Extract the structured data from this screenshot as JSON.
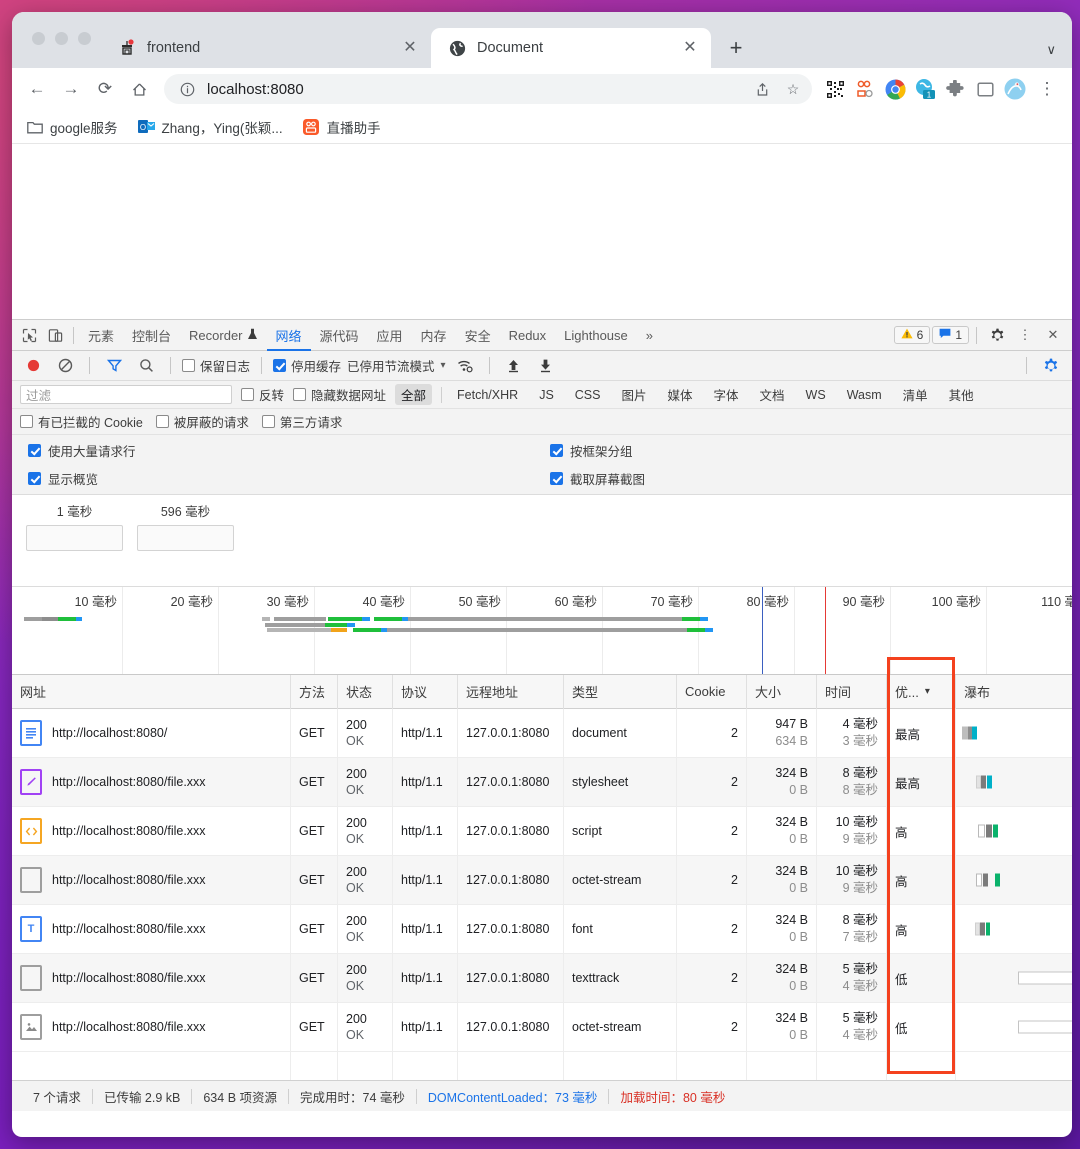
{
  "browser": {
    "tabs": [
      {
        "title": "frontend",
        "favicon": "gaode-icon",
        "active": false
      },
      {
        "title": "Document",
        "favicon": "globe-icon",
        "active": true
      }
    ],
    "newtab_label": "+",
    "tablist_caret": "∨",
    "toolbar": {
      "back": "←",
      "forward": "→",
      "reload": "⟳",
      "home": "⌂",
      "info_icon": "ⓘ",
      "url": "localhost:8080",
      "share_icon": "share-icon",
      "bookmark_icon": "☆",
      "menu_icon": "⋮"
    },
    "bookmarks": [
      {
        "label": "google服务",
        "icon": "folder-icon"
      },
      {
        "label": "Zhang，Ying(张颖...",
        "icon": "outlook-icon"
      },
      {
        "label": "直播助手",
        "icon": "live-assistant-icon"
      }
    ]
  },
  "devtools": {
    "tabs": [
      {
        "label": "元素",
        "selected": false
      },
      {
        "label": "控制台",
        "selected": false
      },
      {
        "label": "Recorder",
        "selected": false,
        "suffix_icon": "flask-icon"
      },
      {
        "label": "网络",
        "selected": true
      },
      {
        "label": "源代码",
        "selected": false
      },
      {
        "label": "应用",
        "selected": false
      },
      {
        "label": "内存",
        "selected": false
      },
      {
        "label": "安全",
        "selected": false
      },
      {
        "label": "Redux",
        "selected": false
      },
      {
        "label": "Lighthouse",
        "selected": false
      },
      {
        "label": "»",
        "selected": false
      }
    ],
    "warning_count": "6",
    "message_count": "1",
    "settings_icon": "gear-icon",
    "more_icon": "⋮",
    "close_icon": "✕",
    "toolbar2": {
      "record_icon": "record-icon",
      "clear_icon": "clear-icon",
      "filter_icon": "funnel-icon",
      "search_icon": "search-icon",
      "preserve_log": {
        "label": "保留日志",
        "checked": false
      },
      "disable_cache": {
        "label": "停用缓存",
        "checked": true
      },
      "throttle": "已停用节流模式",
      "throttle_caret": "▾",
      "wifi_icon": "wifi-settings-icon",
      "import_icon": "upload-icon",
      "export_icon": "download-icon",
      "net_settings_icon": "gear-icon"
    },
    "filterbar": {
      "placeholder": "过滤",
      "value": "",
      "invert": {
        "label": "反转",
        "checked": false
      },
      "hide_data_urls": {
        "label": "隐藏数据网址",
        "checked": false
      },
      "types": [
        "全部",
        "Fetch/XHR",
        "JS",
        "CSS",
        "图片",
        "媒体",
        "字体",
        "文档",
        "WS",
        "Wasm",
        "清单",
        "其他"
      ],
      "selected_type": "全部"
    },
    "checkrow": [
      {
        "label": "有已拦截的 Cookie",
        "checked": false
      },
      {
        "label": "被屏蔽的请求",
        "checked": false
      },
      {
        "label": "第三方请求",
        "checked": false
      }
    ],
    "bigchecks": {
      "left": [
        {
          "label": "使用大量请求行",
          "checked": true
        },
        {
          "label": "显示概览",
          "checked": true
        }
      ],
      "right": [
        {
          "label": "按框架分组",
          "checked": true
        },
        {
          "label": "截取屏幕截图",
          "checked": true
        }
      ]
    },
    "filmstrip": [
      {
        "time": "1 毫秒"
      },
      {
        "time": "596 毫秒"
      }
    ],
    "overview_ticks": [
      "10 毫秒",
      "20 毫秒",
      "30 毫秒",
      "40 毫秒",
      "50 毫秒",
      "60 毫秒",
      "70 毫秒",
      "80 毫秒",
      "90 毫秒",
      "100 毫秒",
      "110 毫"
    ]
  },
  "network": {
    "columns": [
      "网址",
      "方法",
      "状态",
      "协议",
      "远程地址",
      "类型",
      "Cookie",
      "大小",
      "时间",
      "优...",
      "瀑布"
    ],
    "sort_caret": "▾",
    "rows": [
      {
        "icon": "document-icon",
        "url": "http://localhost:8080/",
        "method": "GET",
        "status_code": "200",
        "status_text": "OK",
        "protocol": "http/1.1",
        "remote": "127.0.0.1:8080",
        "type": "document",
        "cookie": "2",
        "size_transfer": "947 B",
        "size_resource": "634 B",
        "time_total": "4 毫秒",
        "time_latency": "3 毫秒",
        "priority": "最高"
      },
      {
        "icon": "stylesheet-icon",
        "url": "http://localhost:8080/file.xxx",
        "method": "GET",
        "status_code": "200",
        "status_text": "OK",
        "protocol": "http/1.1",
        "remote": "127.0.0.1:8080",
        "type": "stylesheet",
        "cookie": "2",
        "size_transfer": "324 B",
        "size_resource": "0 B",
        "time_total": "8 毫秒",
        "time_latency": "8 毫秒",
        "priority": "最高"
      },
      {
        "icon": "script-icon",
        "url": "http://localhost:8080/file.xxx",
        "method": "GET",
        "status_code": "200",
        "status_text": "OK",
        "protocol": "http/1.1",
        "remote": "127.0.0.1:8080",
        "type": "script",
        "cookie": "2",
        "size_transfer": "324 B",
        "size_resource": "0 B",
        "time_total": "10 毫秒",
        "time_latency": "9 毫秒",
        "priority": "高"
      },
      {
        "icon": "blank-icon",
        "url": "http://localhost:8080/file.xxx",
        "method": "GET",
        "status_code": "200",
        "status_text": "OK",
        "protocol": "http/1.1",
        "remote": "127.0.0.1:8080",
        "type": "octet-stream",
        "cookie": "2",
        "size_transfer": "324 B",
        "size_resource": "0 B",
        "time_total": "10 毫秒",
        "time_latency": "9 毫秒",
        "priority": "高"
      },
      {
        "icon": "font-icon",
        "url": "http://localhost:8080/file.xxx",
        "method": "GET",
        "status_code": "200",
        "status_text": "OK",
        "protocol": "http/1.1",
        "remote": "127.0.0.1:8080",
        "type": "font",
        "cookie": "2",
        "size_transfer": "324 B",
        "size_resource": "0 B",
        "time_total": "8 毫秒",
        "time_latency": "7 毫秒",
        "priority": "高"
      },
      {
        "icon": "blank-icon",
        "url": "http://localhost:8080/file.xxx",
        "method": "GET",
        "status_code": "200",
        "status_text": "OK",
        "protocol": "http/1.1",
        "remote": "127.0.0.1:8080",
        "type": "texttrack",
        "cookie": "2",
        "size_transfer": "324 B",
        "size_resource": "0 B",
        "time_total": "5 毫秒",
        "time_latency": "4 毫秒",
        "priority": "低"
      },
      {
        "icon": "image-icon",
        "url": "http://localhost:8080/file.xxx",
        "method": "GET",
        "status_code": "200",
        "status_text": "OK",
        "protocol": "http/1.1",
        "remote": "127.0.0.1:8080",
        "type": "octet-stream",
        "cookie": "2",
        "size_transfer": "324 B",
        "size_resource": "0 B",
        "time_total": "5 毫秒",
        "time_latency": "4 毫秒",
        "priority": "低"
      }
    ],
    "highlight_color": "#f4411e"
  },
  "statusbar": {
    "requests": "7 个请求",
    "transferred": "已传输 2.9 kB",
    "resources": "634 B 项资源",
    "finish": "完成用时：74 毫秒",
    "domcontentloaded": "DOMContentLoaded：73 毫秒",
    "load": "加载时间：80 毫秒"
  }
}
